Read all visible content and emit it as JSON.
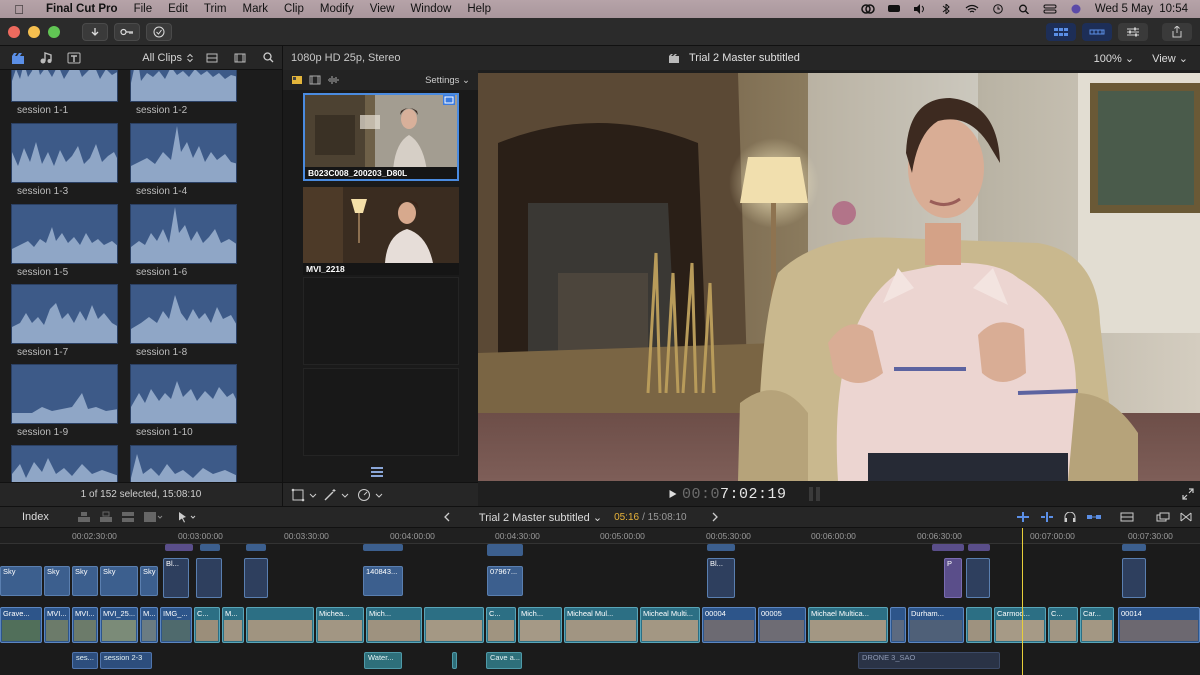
{
  "menubar": {
    "app": "Final Cut Pro",
    "items": [
      "File",
      "Edit",
      "Trim",
      "Mark",
      "Clip",
      "Modify",
      "View",
      "Window",
      "Help"
    ],
    "datetime": "Wed 5 May  10:54"
  },
  "browser": {
    "filter": "All Clips",
    "clips": [
      "session 1-1",
      "session 1-2",
      "session 1-3",
      "session 1-4",
      "session 1-5",
      "session 1-6",
      "session 1-7",
      "session 1-8",
      "session 1-9",
      "session 1-10"
    ],
    "status": "1 of 152 selected, 15:08:10"
  },
  "angle_viewer": {
    "format": "1080p HD 25p, Stereo",
    "settings": "Settings",
    "angles": [
      "B023C008_200203_D80L",
      "MVI_2218"
    ]
  },
  "viewer": {
    "project_title": "Trial 2 Master subtitled",
    "zoom": "100%",
    "view_menu": "View",
    "timecode_dim": "00:0",
    "timecode": "7:02:19"
  },
  "timeline": {
    "index": "Index",
    "project": "Trial 2 Master subtitled",
    "position": "05:16",
    "duration": "/ 15:08:10",
    "ruler": [
      "00:02:30:00",
      "00:03:00:00",
      "00:03:30:00",
      "00:04:00:00",
      "00:04:30:00",
      "00:05:00:00",
      "00:05:30:00",
      "00:06:00:00",
      "00:06:30:00",
      "00:07:00:00",
      "00:07:30:00"
    ],
    "connected": [
      "Sky",
      "Sky",
      "Sky",
      "Sky",
      "Sky",
      "Bl...",
      "140843...",
      "07967...",
      "Bl...",
      "P"
    ],
    "primary": [
      "Grave...",
      "MVI...",
      "MVI...",
      "MVI_25...",
      "M...",
      "IMG_...",
      "C...",
      "M...",
      "Michea...",
      "Mich...",
      "C...",
      "Mich...",
      "Micheal Mul...",
      "Micheal Multi...",
      "00004",
      "00005",
      "Michael Multica...",
      "Durham...",
      "Carmod...",
      "C...",
      "Car...",
      "00014"
    ],
    "lower": [
      "ses...",
      "session 2-3",
      "Water...",
      "Cave a...",
      "DRONE 3_SAO"
    ]
  },
  "colors": {
    "accent": "#4a8be0",
    "playhead": "#e8cf3a",
    "clip_teal": "#2c6f84",
    "clip_blue": "#3c5f8e"
  }
}
